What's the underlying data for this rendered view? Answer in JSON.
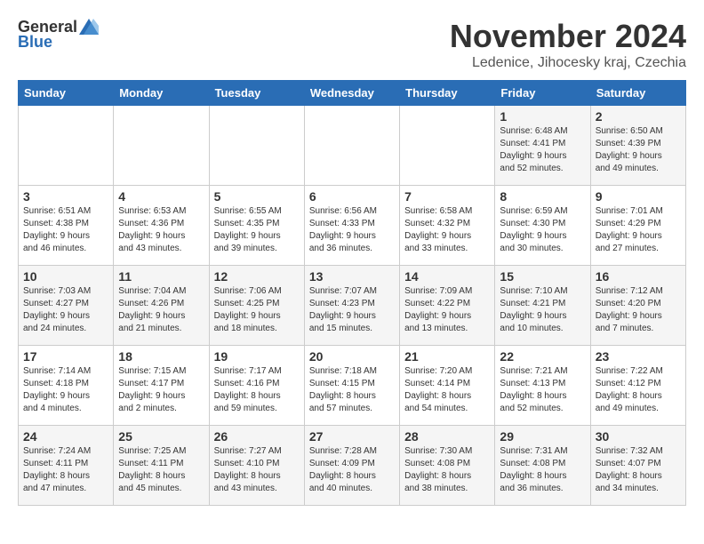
{
  "header": {
    "logo_general": "General",
    "logo_blue": "Blue",
    "title": "November 2024",
    "subtitle": "Ledenice, Jihocesky kraj, Czechia"
  },
  "days_of_week": [
    "Sunday",
    "Monday",
    "Tuesday",
    "Wednesday",
    "Thursday",
    "Friday",
    "Saturday"
  ],
  "weeks": [
    [
      {
        "day": "",
        "info": ""
      },
      {
        "day": "",
        "info": ""
      },
      {
        "day": "",
        "info": ""
      },
      {
        "day": "",
        "info": ""
      },
      {
        "day": "",
        "info": ""
      },
      {
        "day": "1",
        "info": "Sunrise: 6:48 AM\nSunset: 4:41 PM\nDaylight: 9 hours\nand 52 minutes."
      },
      {
        "day": "2",
        "info": "Sunrise: 6:50 AM\nSunset: 4:39 PM\nDaylight: 9 hours\nand 49 minutes."
      }
    ],
    [
      {
        "day": "3",
        "info": "Sunrise: 6:51 AM\nSunset: 4:38 PM\nDaylight: 9 hours\nand 46 minutes."
      },
      {
        "day": "4",
        "info": "Sunrise: 6:53 AM\nSunset: 4:36 PM\nDaylight: 9 hours\nand 43 minutes."
      },
      {
        "day": "5",
        "info": "Sunrise: 6:55 AM\nSunset: 4:35 PM\nDaylight: 9 hours\nand 39 minutes."
      },
      {
        "day": "6",
        "info": "Sunrise: 6:56 AM\nSunset: 4:33 PM\nDaylight: 9 hours\nand 36 minutes."
      },
      {
        "day": "7",
        "info": "Sunrise: 6:58 AM\nSunset: 4:32 PM\nDaylight: 9 hours\nand 33 minutes."
      },
      {
        "day": "8",
        "info": "Sunrise: 6:59 AM\nSunset: 4:30 PM\nDaylight: 9 hours\nand 30 minutes."
      },
      {
        "day": "9",
        "info": "Sunrise: 7:01 AM\nSunset: 4:29 PM\nDaylight: 9 hours\nand 27 minutes."
      }
    ],
    [
      {
        "day": "10",
        "info": "Sunrise: 7:03 AM\nSunset: 4:27 PM\nDaylight: 9 hours\nand 24 minutes."
      },
      {
        "day": "11",
        "info": "Sunrise: 7:04 AM\nSunset: 4:26 PM\nDaylight: 9 hours\nand 21 minutes."
      },
      {
        "day": "12",
        "info": "Sunrise: 7:06 AM\nSunset: 4:25 PM\nDaylight: 9 hours\nand 18 minutes."
      },
      {
        "day": "13",
        "info": "Sunrise: 7:07 AM\nSunset: 4:23 PM\nDaylight: 9 hours\nand 15 minutes."
      },
      {
        "day": "14",
        "info": "Sunrise: 7:09 AM\nSunset: 4:22 PM\nDaylight: 9 hours\nand 13 minutes."
      },
      {
        "day": "15",
        "info": "Sunrise: 7:10 AM\nSunset: 4:21 PM\nDaylight: 9 hours\nand 10 minutes."
      },
      {
        "day": "16",
        "info": "Sunrise: 7:12 AM\nSunset: 4:20 PM\nDaylight: 9 hours\nand 7 minutes."
      }
    ],
    [
      {
        "day": "17",
        "info": "Sunrise: 7:14 AM\nSunset: 4:18 PM\nDaylight: 9 hours\nand 4 minutes."
      },
      {
        "day": "18",
        "info": "Sunrise: 7:15 AM\nSunset: 4:17 PM\nDaylight: 9 hours\nand 2 minutes."
      },
      {
        "day": "19",
        "info": "Sunrise: 7:17 AM\nSunset: 4:16 PM\nDaylight: 8 hours\nand 59 minutes."
      },
      {
        "day": "20",
        "info": "Sunrise: 7:18 AM\nSunset: 4:15 PM\nDaylight: 8 hours\nand 57 minutes."
      },
      {
        "day": "21",
        "info": "Sunrise: 7:20 AM\nSunset: 4:14 PM\nDaylight: 8 hours\nand 54 minutes."
      },
      {
        "day": "22",
        "info": "Sunrise: 7:21 AM\nSunset: 4:13 PM\nDaylight: 8 hours\nand 52 minutes."
      },
      {
        "day": "23",
        "info": "Sunrise: 7:22 AM\nSunset: 4:12 PM\nDaylight: 8 hours\nand 49 minutes."
      }
    ],
    [
      {
        "day": "24",
        "info": "Sunrise: 7:24 AM\nSunset: 4:11 PM\nDaylight: 8 hours\nand 47 minutes."
      },
      {
        "day": "25",
        "info": "Sunrise: 7:25 AM\nSunset: 4:11 PM\nDaylight: 8 hours\nand 45 minutes."
      },
      {
        "day": "26",
        "info": "Sunrise: 7:27 AM\nSunset: 4:10 PM\nDaylight: 8 hours\nand 43 minutes."
      },
      {
        "day": "27",
        "info": "Sunrise: 7:28 AM\nSunset: 4:09 PM\nDaylight: 8 hours\nand 40 minutes."
      },
      {
        "day": "28",
        "info": "Sunrise: 7:30 AM\nSunset: 4:08 PM\nDaylight: 8 hours\nand 38 minutes."
      },
      {
        "day": "29",
        "info": "Sunrise: 7:31 AM\nSunset: 4:08 PM\nDaylight: 8 hours\nand 36 minutes."
      },
      {
        "day": "30",
        "info": "Sunrise: 7:32 AM\nSunset: 4:07 PM\nDaylight: 8 hours\nand 34 minutes."
      }
    ]
  ]
}
